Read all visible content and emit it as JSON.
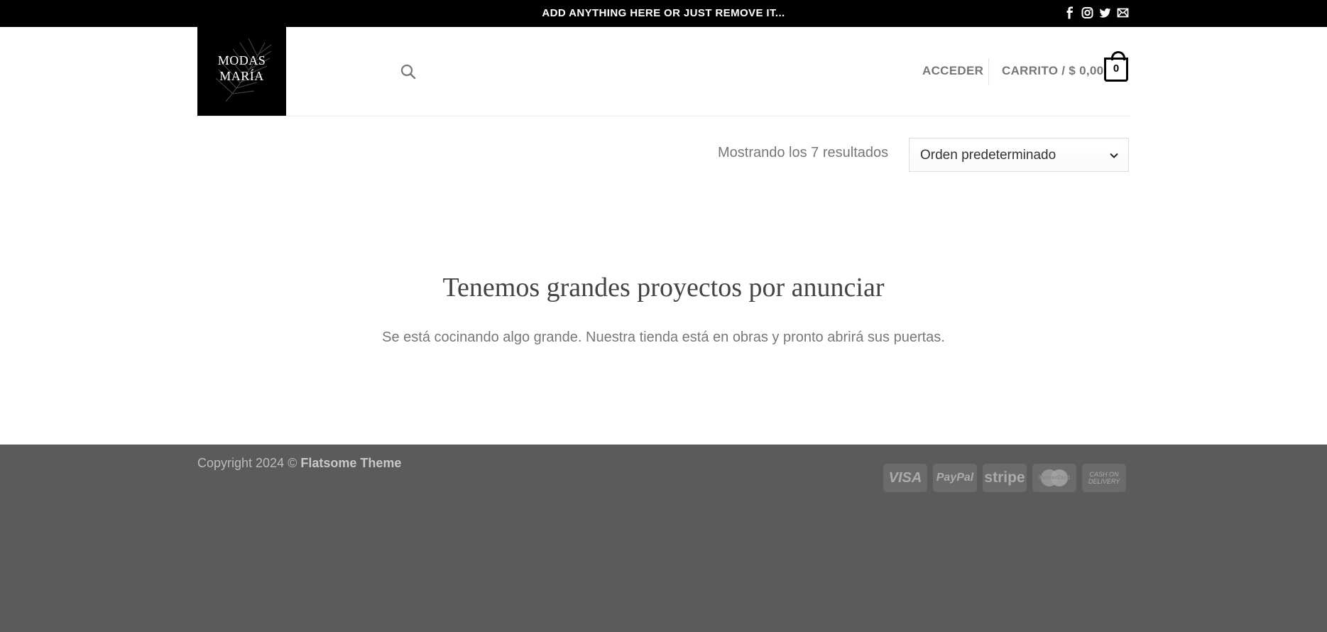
{
  "topbar": {
    "announcement": "ADD ANYTHING HERE OR JUST REMOVE IT...",
    "social_icons": [
      "facebook-icon",
      "instagram-icon",
      "twitter-icon",
      "envelope-icon"
    ]
  },
  "header": {
    "logo_line1": "MODAS",
    "logo_line2": "MARÍA",
    "search_icon": "search-icon",
    "login_label": "ACCEDER",
    "cart_label": "CARRITO / $ 0,00",
    "cart_count": "0"
  },
  "shop": {
    "results_text": "Mostrando los 7 resultados",
    "sort_selected": "Orden predeterminado"
  },
  "main": {
    "heading": "Tenemos grandes proyectos por anunciar",
    "subtext": "Se está cocinando algo grande. Nuestra tienda está en obras y pronto abrirá sus puertas."
  },
  "footer": {
    "copyright_prefix": "Copyright 2024 © ",
    "copyright_brand": "Flatsome Theme",
    "payments": {
      "visa": "VISA",
      "paypal": "PayPal",
      "stripe": "stripe",
      "mastercard": "MasterCard",
      "cod_line1": "CASH ON",
      "cod_line2": "DELIVERY"
    }
  },
  "colors": {
    "topbar_bg": "#000000",
    "footer_bg": "#5b5b5b",
    "text_muted": "#777777"
  }
}
